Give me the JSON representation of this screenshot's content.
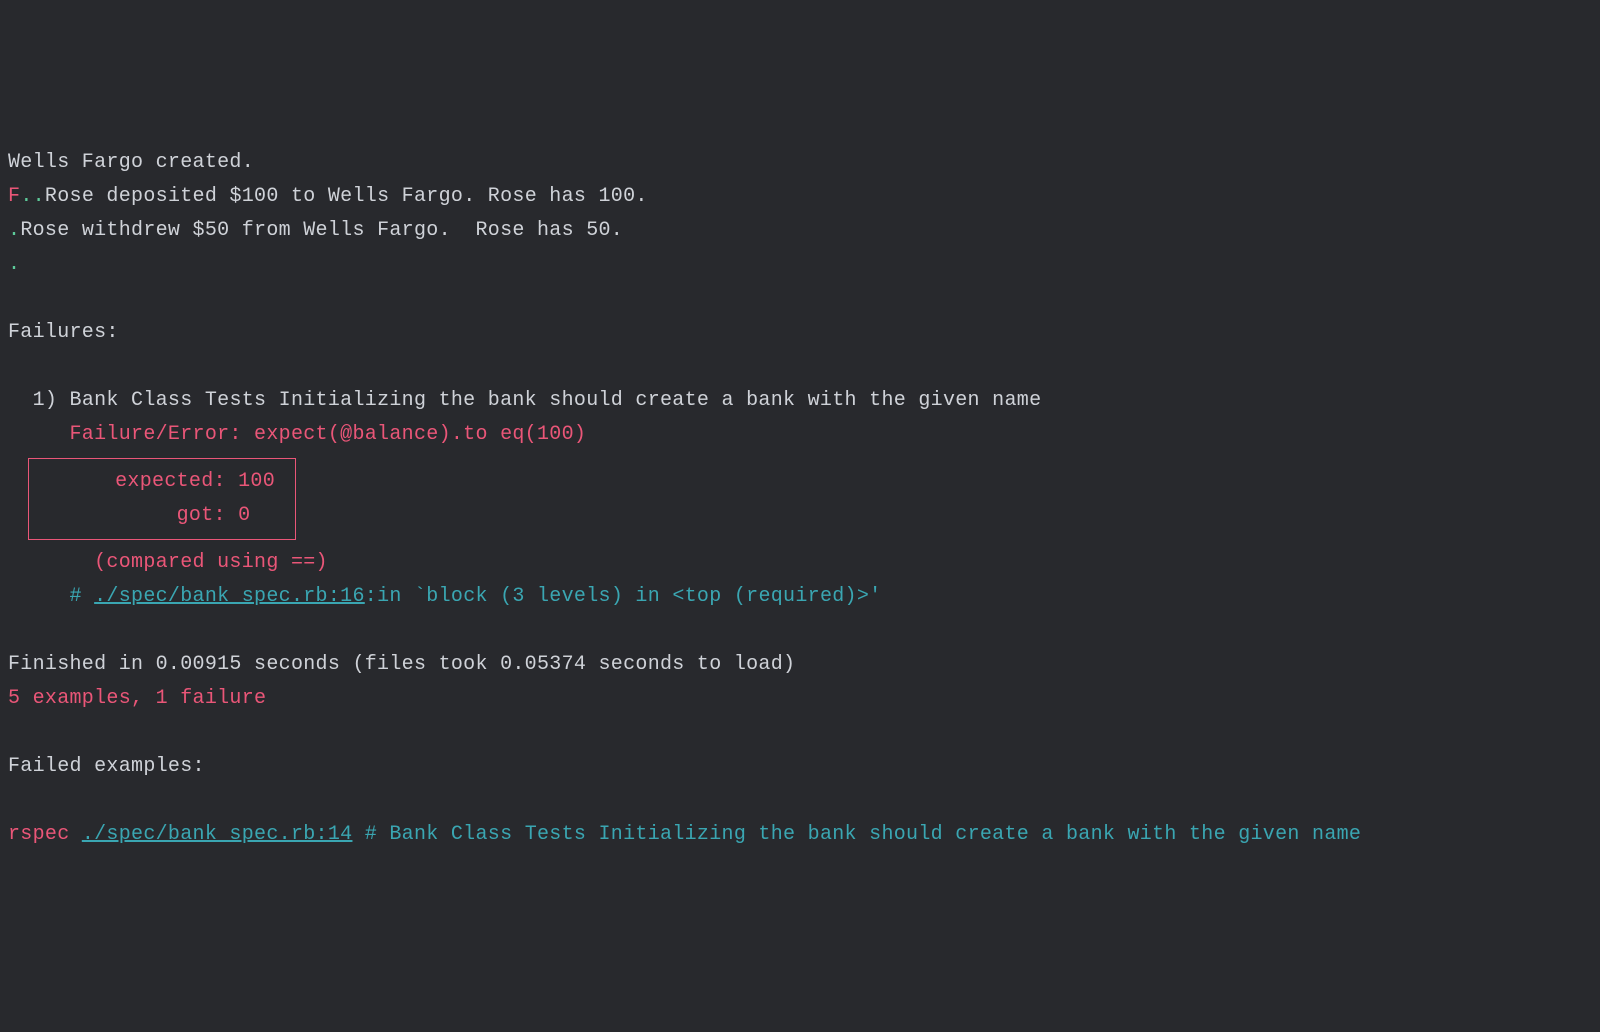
{
  "output": {
    "created": "Wells Fargo created.",
    "fail_marker": "F",
    "dots1": "..",
    "deposit": "Rose deposited $100 to Wells Fargo. Rose has 100.",
    "dot2": ".",
    "withdraw": "Rose withdrew $50 from Wells Fargo.  Rose has 50.",
    "dot3": "."
  },
  "failures_header": "Failures:",
  "failure": {
    "index": "  1) ",
    "desc": "Bank Class Tests Initializing the bank should create a bank with the given name",
    "error_line": "     Failure/Error: expect(@balance).to eq(100)",
    "expected": "       expected: 100",
    "got": "            got: 0",
    "compared": "       (compared using ==)",
    "trace_hash": "     # ",
    "trace_link": "./spec/bank_spec.rb:16",
    "trace_rest": ":in `block (3 levels) in <top (required)>'"
  },
  "summary": {
    "finished": "Finished in 0.00915 seconds (files took 0.05374 seconds to load)",
    "counts": "5 examples, 1 failure"
  },
  "failed_header": "Failed examples:",
  "failed_example": {
    "cmd": "rspec ",
    "link": "./spec/bank_spec.rb:14",
    "comment": " # Bank Class Tests Initializing the bank should create a bank with the given name"
  }
}
